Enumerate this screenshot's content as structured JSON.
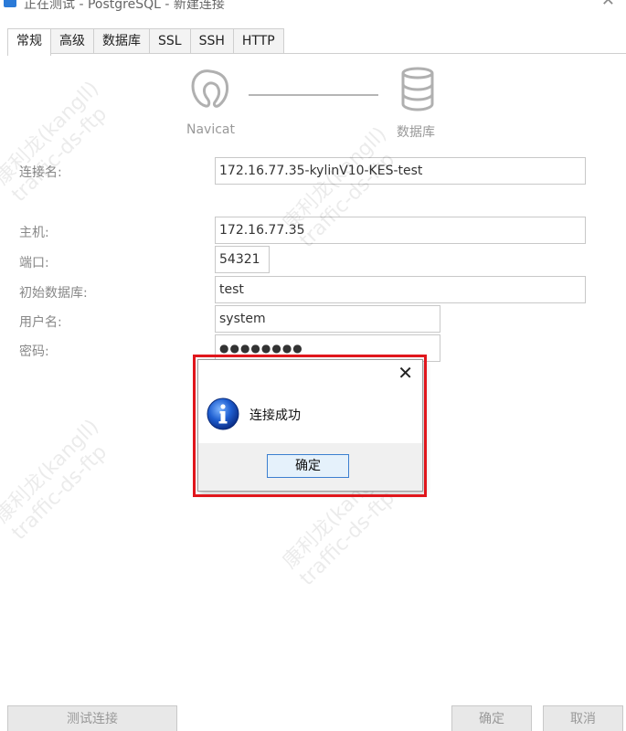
{
  "window": {
    "title": "正在测试 - PostgreSQL - 新建连接",
    "close_glyph": "✕"
  },
  "tabs": [
    {
      "label": "常规",
      "active": true
    },
    {
      "label": "高级",
      "active": false
    },
    {
      "label": "数据库",
      "active": false
    },
    {
      "label": "SSL",
      "active": false
    },
    {
      "label": "SSH",
      "active": false
    },
    {
      "label": "HTTP",
      "active": false
    }
  ],
  "diagram": {
    "left_label": "Navicat",
    "right_label": "数据库",
    "left_icon": "navicat-logo-icon",
    "right_icon": "database-icon"
  },
  "form": {
    "connection_name": {
      "label": "连接名:",
      "value": "172.16.77.35-kylinV10-KES-test"
    },
    "host": {
      "label": "主机:",
      "value": "172.16.77.35"
    },
    "port": {
      "label": "端口:",
      "value": "54321"
    },
    "initial_db": {
      "label": "初始数据库:",
      "value": "test"
    },
    "username": {
      "label": "用户名:",
      "value": "system"
    },
    "password": {
      "label": "密码:",
      "value": "●●●●●●●●"
    }
  },
  "dialog": {
    "message": "连接成功",
    "ok_label": "确定",
    "close_glyph": "✕",
    "icon": "info-icon",
    "highlight_color": "#e0161c"
  },
  "buttons": {
    "test_connection": "测试连接",
    "ok": "确定",
    "cancel": "取消"
  },
  "watermark": {
    "name": "康利龙(kangll)",
    "org": "traffic-ds-ftp"
  }
}
